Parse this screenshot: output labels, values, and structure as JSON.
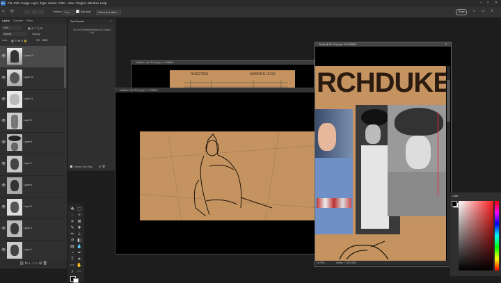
{
  "menubar": {
    "items": [
      "File",
      "Edit",
      "Image",
      "Layer",
      "Type",
      "Select",
      "Filter",
      "View",
      "Plugins",
      "Window",
      "Help"
    ],
    "share_label": "Share"
  },
  "options": {
    "feather_label": "Feather:",
    "feather_value": "0 px",
    "anti_alias_label": "Anti-alias",
    "select_mask_label": "Select and Mask..."
  },
  "layers_panel": {
    "tabs": [
      "Layers",
      "Channels",
      "Paths"
    ],
    "kind_label": "Kind",
    "blend_mode": "Normal",
    "opacity_label": "Opacity:",
    "lock_label": "Lock:",
    "fill_label": "Fill:",
    "fill_value": "100%",
    "layers": [
      {
        "name": "Layer 13"
      },
      {
        "name": "Layer 12"
      },
      {
        "name": "Layer 11"
      },
      {
        "name": "Layer 9"
      },
      {
        "name": "Layer 8"
      },
      {
        "name": "Layer 7"
      },
      {
        "name": "Layer 6"
      },
      {
        "name": "Layer 5"
      },
      {
        "name": "Layer 4"
      },
      {
        "name": "Layer 1"
      }
    ]
  },
  "tool_presets": {
    "title": "Tool Presets",
    "empty_message": "No Tool Presets defined for Current Tool",
    "current_tool_only": "Current Tool Only"
  },
  "documents": {
    "back_title": "Untitled-1 @ 25% (Layer 4, RGB/8) *",
    "mid_title": "Untitled-2 @ 33% (Layer 4, RGB/8) *",
    "front_title": "5.psd @ 16.7% (Layer 16, RGB/8) *",
    "front_zoom": "16.75%",
    "front_info": "Inches: 7.49(7.630)",
    "sketch_labels": [
      "SHEETING",
      "ARMORS LEGS"
    ],
    "poster_text": "RCHDUKE"
  },
  "color_panel": {
    "title": "Color"
  },
  "colors": {
    "canvas_bg": "#c4935f",
    "accent_blue": "#2d6db5"
  }
}
